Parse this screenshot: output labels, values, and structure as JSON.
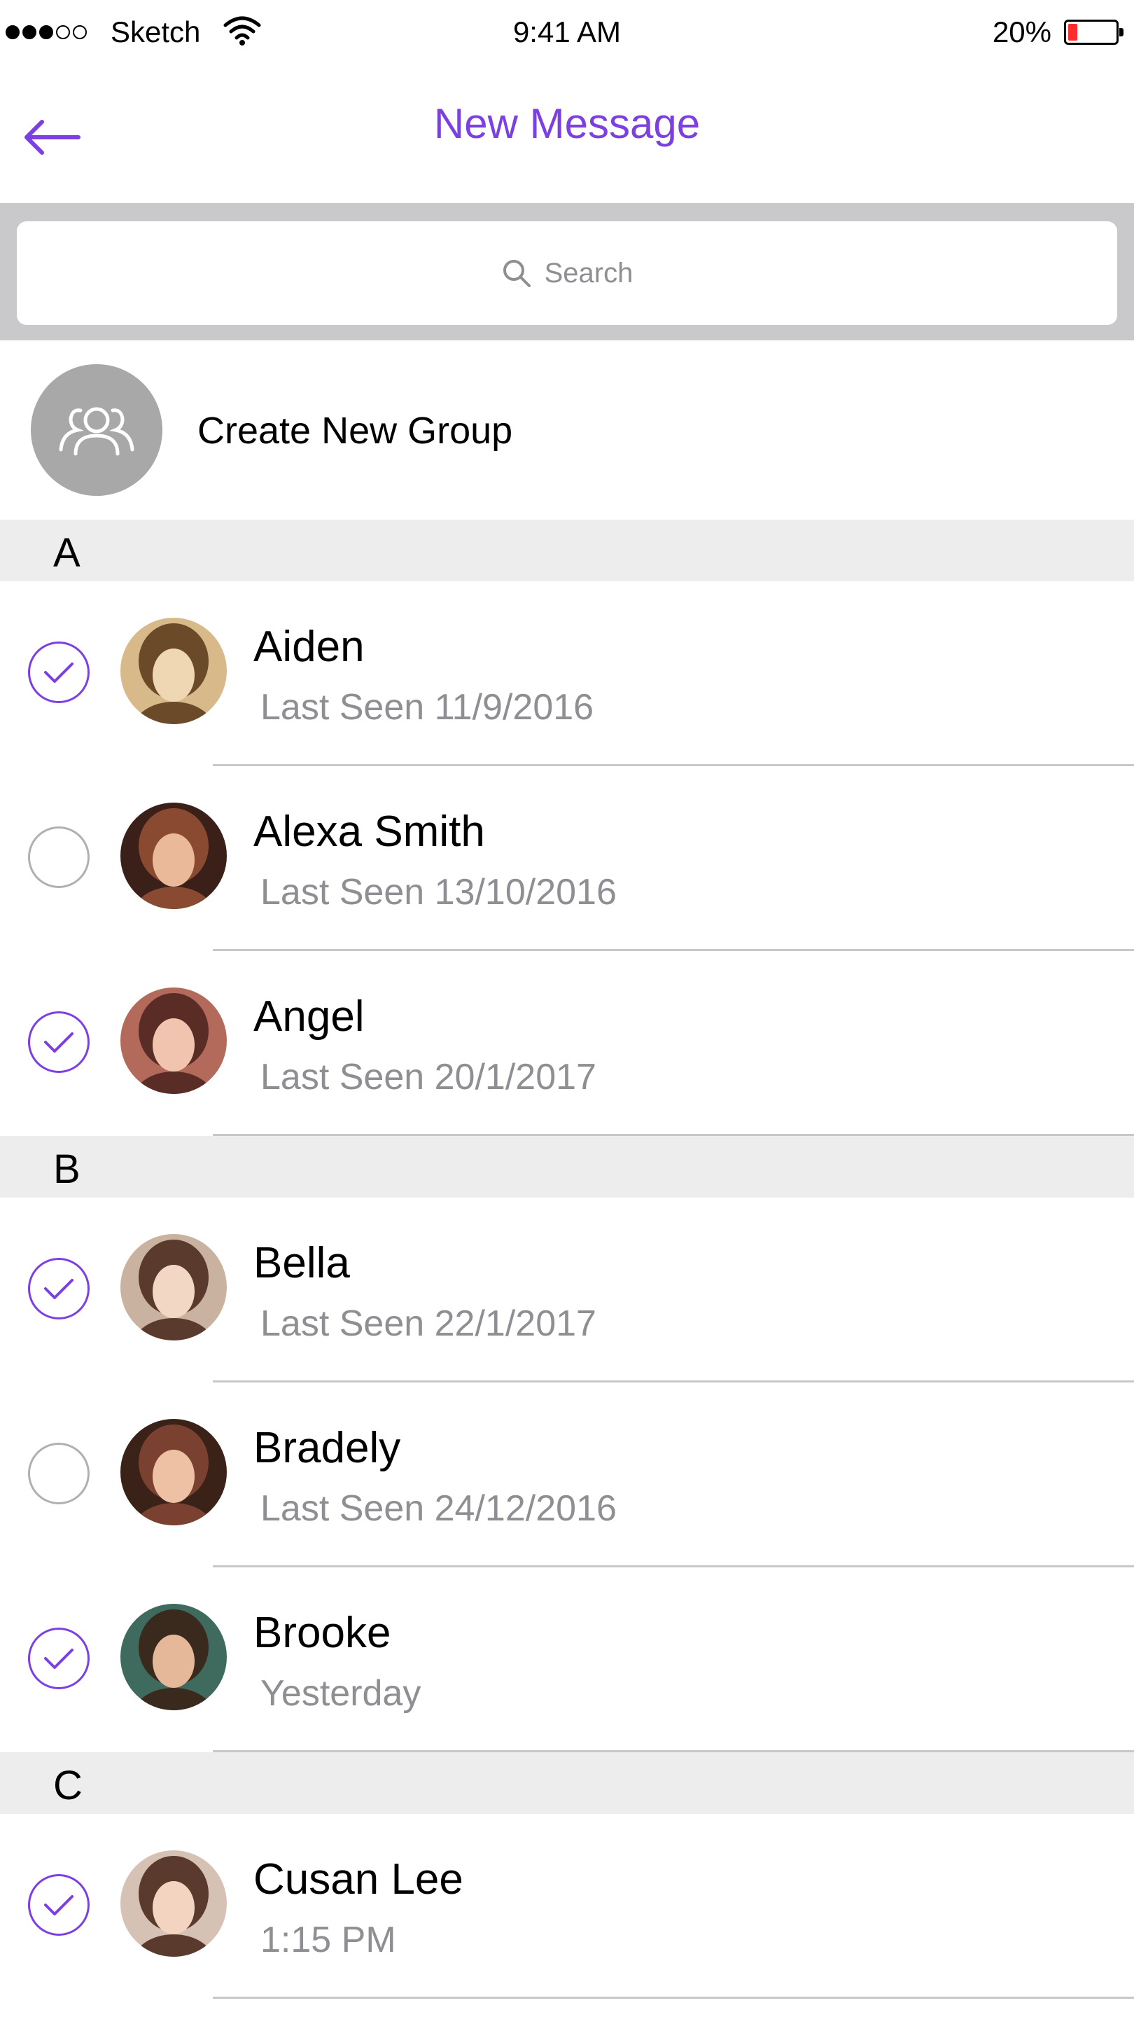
{
  "status_bar": {
    "carrier": "Sketch",
    "time": "9:41 AM",
    "battery_percent": "20%",
    "battery_level": 0.2,
    "signal_bars": 3
  },
  "nav": {
    "title": "New Message",
    "accent_color": "#7b3fe4",
    "back_icon": "arrow-left-icon"
  },
  "search": {
    "placeholder": "Search",
    "icon": "search-icon"
  },
  "create_group": {
    "label": "Create New Group",
    "icon": "group-icon"
  },
  "sections": [
    {
      "letter": "A",
      "contacts": [
        {
          "name": "Aiden",
          "subtitle": "Last Seen 11/9/2016",
          "selected": true
        },
        {
          "name": "Alexa Smith",
          "subtitle": "Last Seen 13/10/2016",
          "selected": false
        },
        {
          "name": "Angel",
          "subtitle": "Last Seen 20/1/2017",
          "selected": true
        }
      ]
    },
    {
      "letter": "B",
      "contacts": [
        {
          "name": "Bella",
          "subtitle": "Last Seen 22/1/2017",
          "selected": true
        },
        {
          "name": "Bradely",
          "subtitle": "Last Seen 24/12/2016",
          "selected": false
        },
        {
          "name": "Brooke",
          "subtitle": "Yesterday",
          "selected": true
        }
      ]
    },
    {
      "letter": "C",
      "contacts": [
        {
          "name": "Cusan Lee",
          "subtitle": "1:15 PM",
          "selected": true
        }
      ]
    }
  ]
}
